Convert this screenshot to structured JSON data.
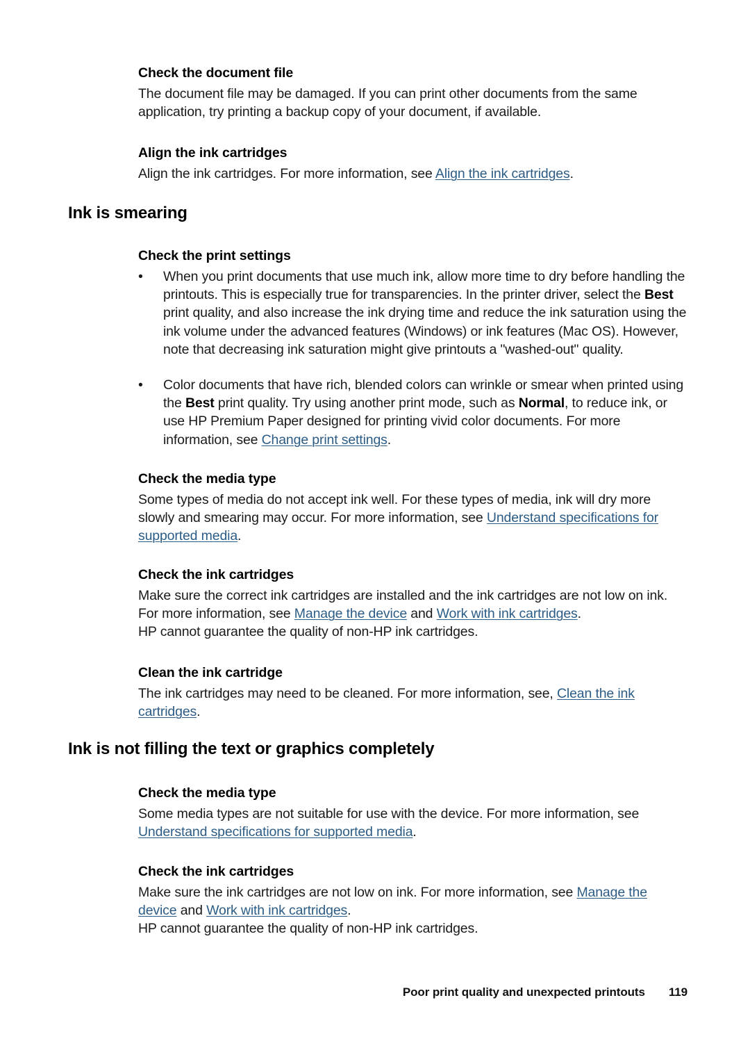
{
  "page": {
    "number": "119",
    "footer_title": "Poor print quality and unexpected printouts",
    "background": "#ffffff",
    "link_color": "#2C5C85",
    "text_color": "#1a1a1a"
  },
  "sections": {
    "check_document_file": {
      "heading": "Check the document file",
      "body_line1": "The document file may be damaged. If you can print other documents from the same",
      "body_line2": "application, try printing a backup copy of your document, if available."
    },
    "align_ink_cartridges": {
      "heading": "Align the ink cartridges",
      "body_prefix": "Align the ink cartridges. For more information, see ",
      "link": "Align the ink cartridges",
      "body_suffix": "."
    },
    "ink_is_smearing": {
      "heading": "Ink is smearing",
      "check_print_settings": {
        "heading": "Check the print settings",
        "bullet_marker": "•",
        "bullets": [
          {
            "part1": "When you print documents that use much ink, allow more time to dry before handling the printouts. This is especially true for transparencies. In the printer driver, select the ",
            "bold1": "Best",
            "part2": " print quality, and also increase the ink drying time and reduce the ink saturation using the ink volume under the advanced features (Windows) or ink features (Mac OS). However, note that decreasing ink saturation might give printouts a \"washed-out\" quality."
          },
          {
            "part1": "Color documents that have rich, blended colors can wrinkle or smear when printed using the ",
            "bold1": "Best",
            "part2": " print quality. Try using another print mode, such as ",
            "bold2": "Normal",
            "part3": ", to reduce ink, or use HP Premium Paper designed for printing vivid color documents. For more information, see ",
            "link": "Change print settings",
            "part4": "."
          }
        ]
      },
      "check_media_type": {
        "heading": "Check the media type",
        "body_prefix": "Some types of media do not accept ink well. For these types of media, ink will dry more slowly and smearing may occur. For more information, see ",
        "link": "Understand specifications for supported media",
        "body_suffix": "."
      },
      "check_ink_cartridges": {
        "heading": "Check the ink cartridges",
        "body_prefix": "Make sure the correct ink cartridges are installed and the ink cartridges are not low on ink. For more information, see ",
        "link1": "Manage the device",
        "body_mid": " and ",
        "link2": "Work with ink cartridges",
        "body_suffix": ".",
        "body_line3": "HP cannot guarantee the quality of non-HP ink cartridges."
      },
      "clean_ink_cartridge": {
        "heading": "Clean the ink cartridge",
        "body_prefix": "The ink cartridges may need to be cleaned. For more information, see, ",
        "link": "Clean the ink cartridges",
        "body_suffix": "."
      }
    },
    "ink_not_filling": {
      "heading": "Ink is not filling the text or graphics completely",
      "check_media_type": {
        "heading": "Check the media type",
        "body_prefix": "Some media types are not suitable for use with the device. For more information, see ",
        "link": "Understand specifications for supported media",
        "body_suffix": "."
      },
      "check_ink_cartridges": {
        "heading": "Check the ink cartridges",
        "body_prefix": "Make sure the ink cartridges are not low on ink. For more information, see ",
        "link1": "Manage the device",
        "body_mid": " and ",
        "link2": "Work with ink cartridges",
        "body_suffix": ".",
        "body_line3": "HP cannot guarantee the quality of non-HP ink cartridges."
      }
    }
  }
}
